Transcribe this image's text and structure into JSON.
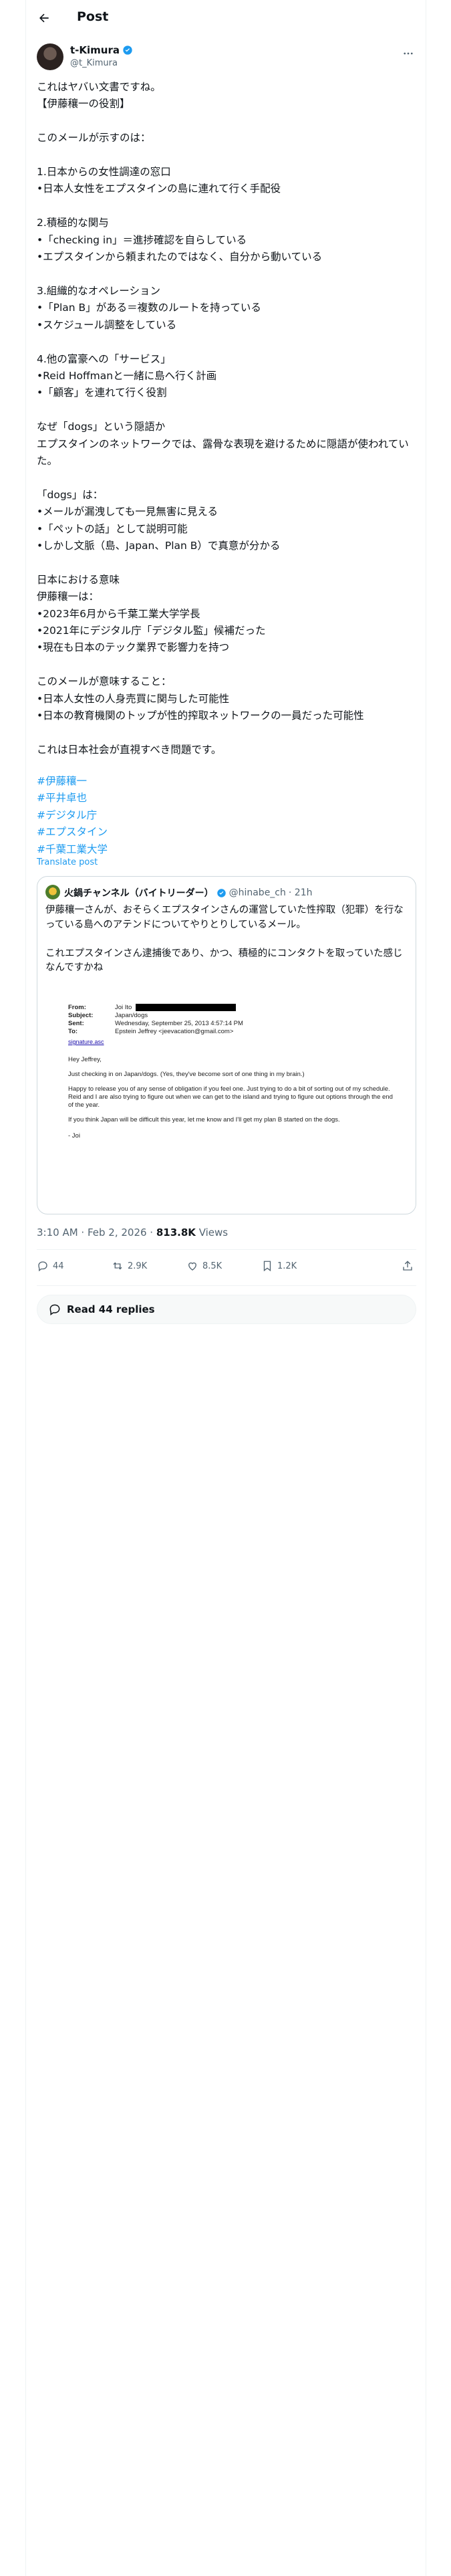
{
  "header": {
    "title": "Post",
    "back_icon": "arrow-left-icon"
  },
  "author": {
    "name": "t-Kimura",
    "handle": "@t_Kimura",
    "verified": true,
    "verified_color": "#1d9bf0"
  },
  "post": {
    "text": "これはヤバい文書ですね。\n【伊藤穰一の役割】\n\nこのメールが示すのは：\n\n1.日本からの女性調達の窓口\n•日本人女性をエプスタインの島に連れて行く手配役\n\n2.積極的な関与\n•「checking in」＝進捗確認を自らしている\n•エプスタインから頼まれたのではなく、自分から動いている\n\n3.組織的なオペレーション\n•「Plan B」がある＝複数のルートを持っている\n•スケジュール調整をしている\n\n4.他の富豪への「サービス」\n•Reid Hoffmanと一緒に島へ行く計画\n•「顧客」を連れて行く役割\n\nなぜ「dogs」という隠語か\nエプスタインのネットワークでは、露骨な表現を避けるために隠語が使われていた。\n\n「dogs」は：\n•メールが漏洩しても一見無害に見える\n•「ペットの話」として説明可能\n•しかし文脈（島、Japan、Plan B）で真意が分かる\n\n日本における意味\n伊藤穰一は：\n•2023年6月から千葉工業大学学長\n•2021年にデジタル庁「デジタル監」候補だった\n•現在も日本のテック業界で影響力を持つ\n\nこのメールが意味すること：\n•日本人女性の人身売買に関与した可能性\n•日本の教育機関のトップが性的搾取ネットワークの一員だった可能性\n\nこれは日本社会が直視すべき問題です。",
    "hashtags": [
      "#伊藤穰一",
      "#平井卓也",
      "#デジタル庁",
      "#エプスタイン",
      "#千葉工業大学"
    ],
    "translate_label": "Translate post"
  },
  "quote": {
    "name": "火鍋チャンネル（バイトリーダー）",
    "handle": "@hinabe_ch",
    "time": "· 21h",
    "text": "伊藤穰一さんが、おそらくエプスタインさんの運営していた性搾取（犯罪）を行なっている島へのアテンドについてやりとりしているメール。\n\nこれエプスタインさん逮捕後であり、かつ、積極的にコンタクトを取っていた感じなんですかね",
    "email": {
      "from_label": "From:",
      "from_value": "Joi Ito",
      "subject_label": "Subject:",
      "subject_value": "Japan/dogs",
      "sent_label": "Sent:",
      "sent_value": "Wednesday, September 25, 2013 4:57:14 PM",
      "to_label": "To:",
      "to_value": "Epstein Jeffrey <jeevacation@gmail.com>",
      "signature": "signature.asc",
      "greeting": "Hey Jeffrey,",
      "line1": "Just checking in on Japan/dogs. (Yes, they've become sort of one thing in my brain.)",
      "line2": "Happy to release you of any sense of obligation if you feel one. Just trying to do a bit of sorting out of my schedule. Reid and I are also trying to figure out when we can get to the island and trying to figure out options through the end of the year.",
      "line3": "If you think Japan will be difficult this year, let me know and I'll get my plan B started on the dogs.",
      "closing": "- Joi"
    }
  },
  "meta": {
    "time": "3:10 AM · Feb 2, 2026 · ",
    "views": "813.8K",
    "views_label": " Views"
  },
  "actions": {
    "replies": "44",
    "reposts": "2.9K",
    "likes": "8.5K",
    "bookmarks": "1.2K"
  },
  "read_replies": "Read 44 replies"
}
